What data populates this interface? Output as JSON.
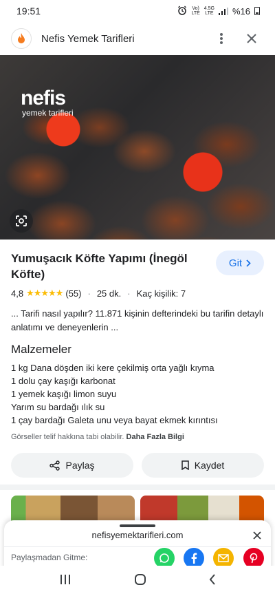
{
  "status_bar": {
    "time": "19:51",
    "volte_top": "Vo)",
    "volte_bottom": "LTE",
    "net_top": "4.5G",
    "net_bottom": "LTE",
    "battery": "%16"
  },
  "app_bar": {
    "title": "Nefis Yemek Tarifleri",
    "logo_icon": "flame-icon",
    "menu_icon": "more-vertical-icon",
    "close_icon": "close-icon"
  },
  "hero": {
    "watermark_main": "nefis",
    "watermark_sub": "yemek tarifleri",
    "lens_icon": "google-lens-icon"
  },
  "recipe": {
    "title": "Yumuşacık Köfte Yapımı (İnegöl Köfte)",
    "go_button": "Git",
    "rating": "4,8",
    "stars": "★★★★★",
    "review_count": "(55)",
    "time": "25 dk.",
    "servings": "Kaç kişilik: 7",
    "description": "... Tarifi nasıl yapılır? 11.871 kişinin defterindeki bu tarifin detaylı anlatımı ve deneyenlerin ...",
    "ingredients_heading": "Malzemeler",
    "ingredients": [
      "1 kg Dana döşden iki kere çekilmiş orta yağlı kıyma",
      "1 dolu çay kaşığı karbonat",
      "1 yemek kaşığı limon suyu",
      "Yarım su bardağı ılık su",
      "1 çay bardağı Galeta unu veya bayat ekmek kırıntısı"
    ],
    "copyright_text": "Görseller telif hakkına tabi olabilir.",
    "copyright_link": "Daha Fazla Bilgi",
    "share_label": "Paylaş",
    "save_label": "Kaydet"
  },
  "share_sheet": {
    "url": "nefisyemektarifleri.com",
    "label": "Paylaşmadan Gitme:",
    "apps": [
      "whatsapp-icon",
      "facebook-icon",
      "email-icon",
      "pinterest-icon"
    ]
  },
  "nav": {
    "recents_icon": "recents-icon",
    "home_icon": "home-icon",
    "back_icon": "back-icon"
  },
  "colors": {
    "accent": "#1a73e8",
    "go_bg": "#e8f0fe",
    "star": "#fbbc04",
    "whatsapp": "#25d366",
    "facebook": "#1877f2",
    "email": "#f4b400",
    "pinterest": "#e60023"
  }
}
